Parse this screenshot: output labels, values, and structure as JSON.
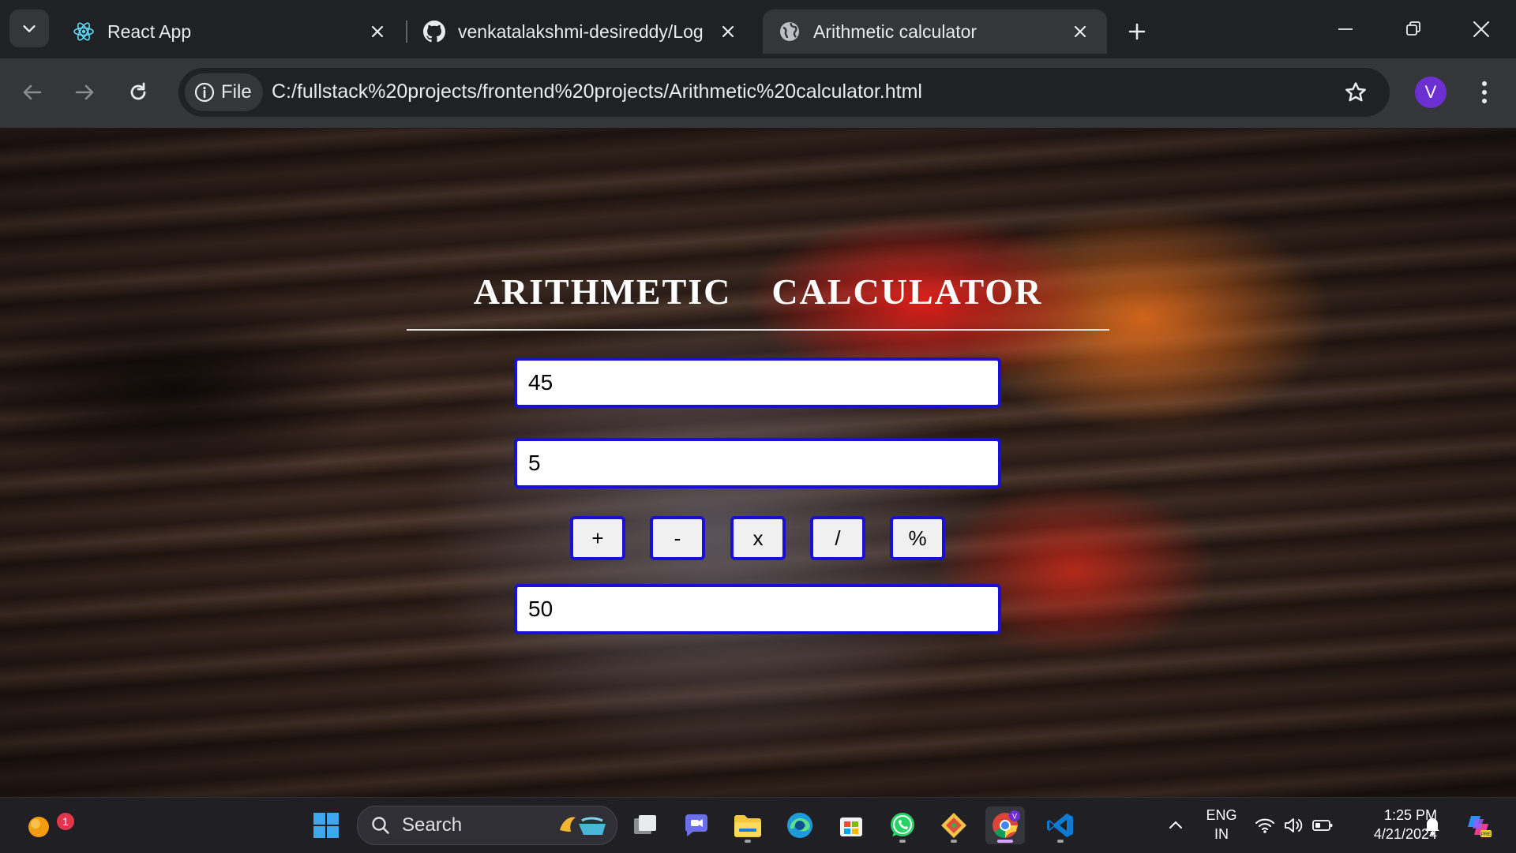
{
  "browser": {
    "tabs": [
      {
        "title": "React App",
        "icon": "react-icon",
        "active": false
      },
      {
        "title": "venkatalakshmi-desireddy/Log",
        "icon": "github-icon",
        "active": false
      },
      {
        "title": "Arithmetic calculator",
        "icon": "globe-icon",
        "active": true
      }
    ],
    "site_chip_label": "File",
    "url": "C:/fullstack%20projects/frontend%20projects/Arithmetic%20calculator.html",
    "profile_initial": "V"
  },
  "calculator": {
    "title": "ARITHMETIC  CALCULATOR",
    "first_number": "45",
    "second_number": "5",
    "operations": [
      "+",
      "-",
      "x",
      "/",
      "%"
    ],
    "result": "50"
  },
  "taskbar": {
    "search_label": "Search",
    "notification_count": "1",
    "language": "ENG",
    "region": "IN",
    "time": "1:25 PM",
    "date": "4/21/2024"
  },
  "colors": {
    "input_border": "#1a0fd6",
    "chrome_dark": "#202124",
    "chrome_toolbar": "#35363a",
    "profile": "#6c2fd1"
  }
}
